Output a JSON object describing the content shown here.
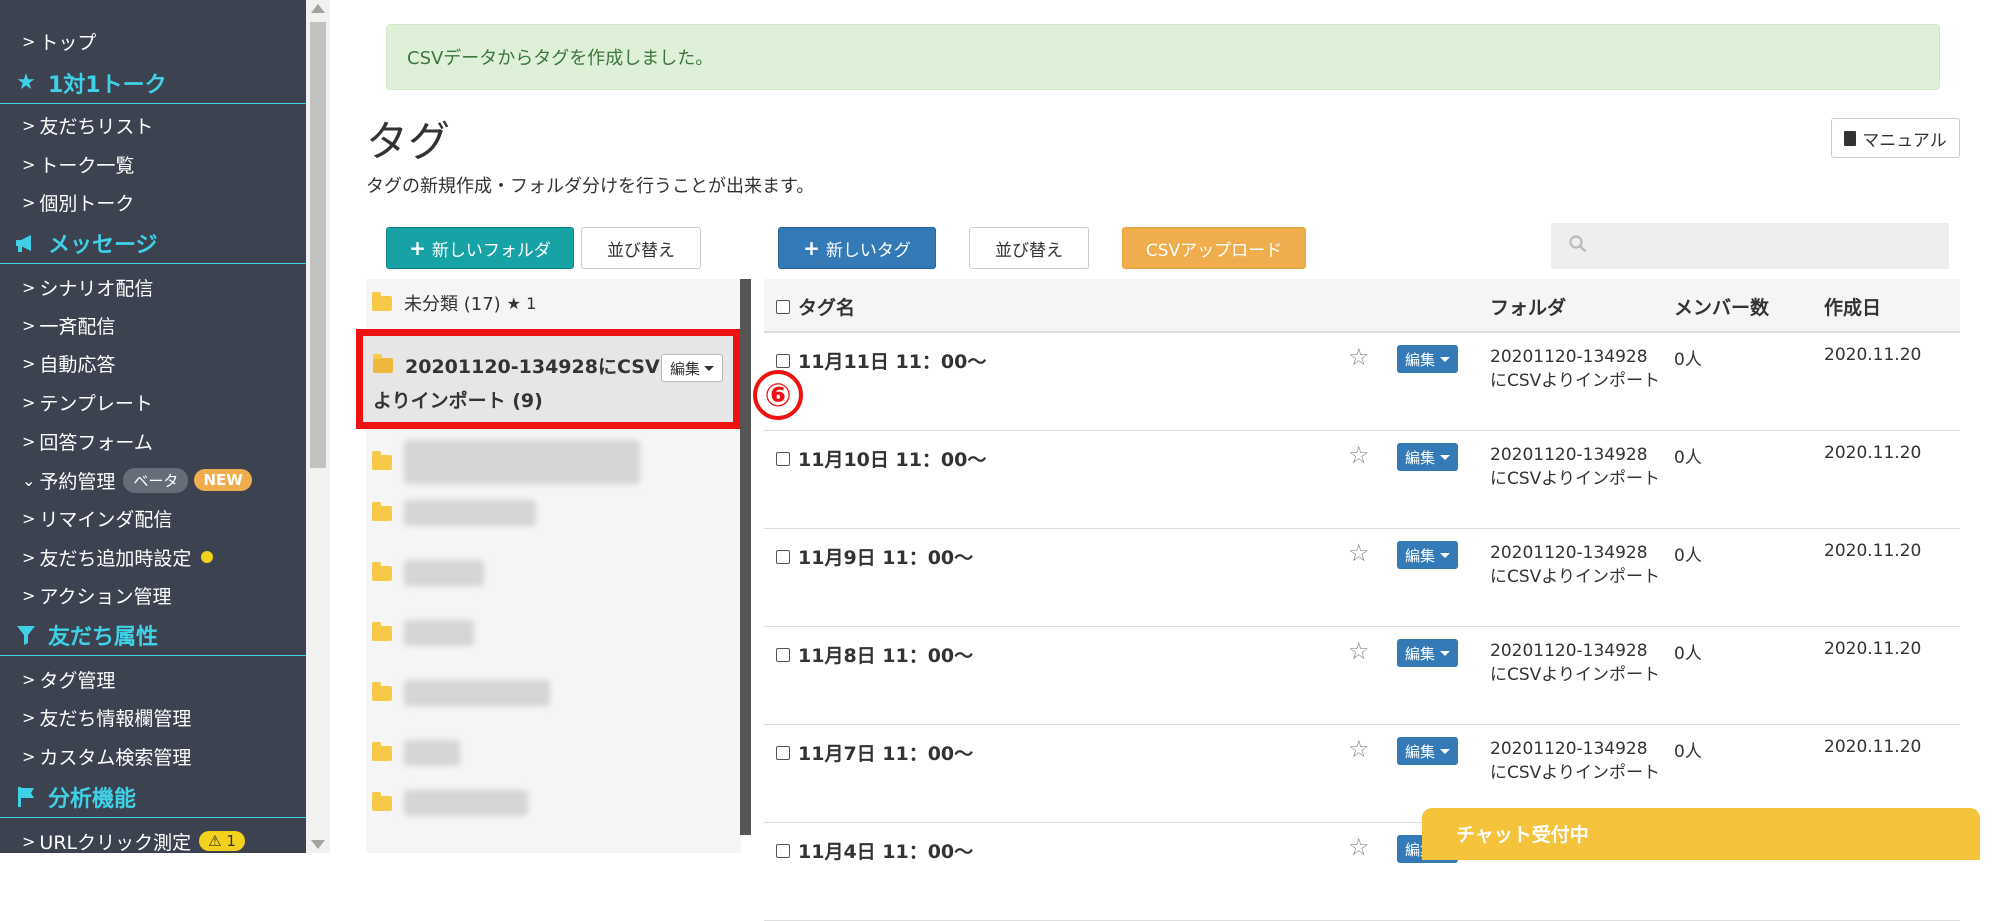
{
  "sidebar": {
    "items": [
      {
        "label": "トップ"
      },
      {
        "label": "友だちリスト"
      },
      {
        "label": "トーク一覧"
      },
      {
        "label": "個別トーク"
      },
      {
        "label": "シナリオ配信"
      },
      {
        "label": "一斉配信"
      },
      {
        "label": "自動応答"
      },
      {
        "label": "テンプレート"
      },
      {
        "label": "回答フォーム"
      },
      {
        "label": "予約管理",
        "badge": "ベータ",
        "badge2": "NEW"
      },
      {
        "label": "リマインダ配信"
      },
      {
        "label": "友だち追加時設定"
      },
      {
        "label": "アクション管理"
      },
      {
        "label": "タグ管理"
      },
      {
        "label": "友だち情報欄管理"
      },
      {
        "label": "カスタム検索管理"
      },
      {
        "label": "URLクリック測定",
        "badge": "1"
      }
    ],
    "sections": [
      {
        "label": "1対1トーク",
        "icon": "star-icon"
      },
      {
        "label": "メッセージ",
        "icon": "megaphone-icon"
      },
      {
        "label": "友だち属性",
        "icon": "filter-icon"
      },
      {
        "label": "分析機能",
        "icon": "flag-icon"
      }
    ]
  },
  "alert": {
    "text": "CSVデータからタグを作成しました。"
  },
  "page": {
    "title": "タグ",
    "description": "タグの新規作成・フォルダ分けを行うことが出来ます。",
    "manual_label": "マニュアル"
  },
  "toolbar": {
    "new_folder": "新しいフォルダ",
    "sort_folders": "並び替え",
    "new_tag": "新しいタグ",
    "sort_tags": "並び替え",
    "csv_upload": "CSVアップロード"
  },
  "folders": {
    "uncategorized": {
      "label": "未分類 (17)",
      "star_count": "★ 1"
    },
    "selected": {
      "label_line1": "20201120-134928にCSV",
      "label_line2": "よりインポート (9)",
      "edit_label": "編集"
    },
    "step_number": "⑥"
  },
  "table": {
    "headers": {
      "name": "タグ名",
      "folder": "フォルダ",
      "members": "メンバー数",
      "created": "作成日"
    },
    "edit_label": "編集",
    "rows": [
      {
        "name": "11月11日 11：00〜",
        "folder": "20201120-134928にCSVよりインポート",
        "members": "0人",
        "created": "2020.11.20"
      },
      {
        "name": "11月10日 11：00〜",
        "folder": "20201120-134928にCSVよりインポート",
        "members": "0人",
        "created": "2020.11.20"
      },
      {
        "name": "11月9日 11：00〜",
        "folder": "20201120-134928にCSVよりインポート",
        "members": "0人",
        "created": "2020.11.20"
      },
      {
        "name": "11月8日 11：00〜",
        "folder": "20201120-134928にCSVよりインポート",
        "members": "0人",
        "created": "2020.11.20"
      },
      {
        "name": "11月7日 11：00〜",
        "folder": "20201120-134928にCSVよりインポート",
        "members": "0人",
        "created": "2020.11.20"
      },
      {
        "name": "11月4日 11：00〜",
        "folder": "",
        "members": "",
        "created": ""
      }
    ]
  },
  "chat": {
    "label": "チャット受付中"
  },
  "colors": {
    "sidebar_bg": "#3c4250",
    "sidebar_accent": "#3fd1e6",
    "highlight": "#ee1111",
    "primary": "#337ab7",
    "teal": "#17a2a6",
    "orange": "#f0ad4e"
  }
}
